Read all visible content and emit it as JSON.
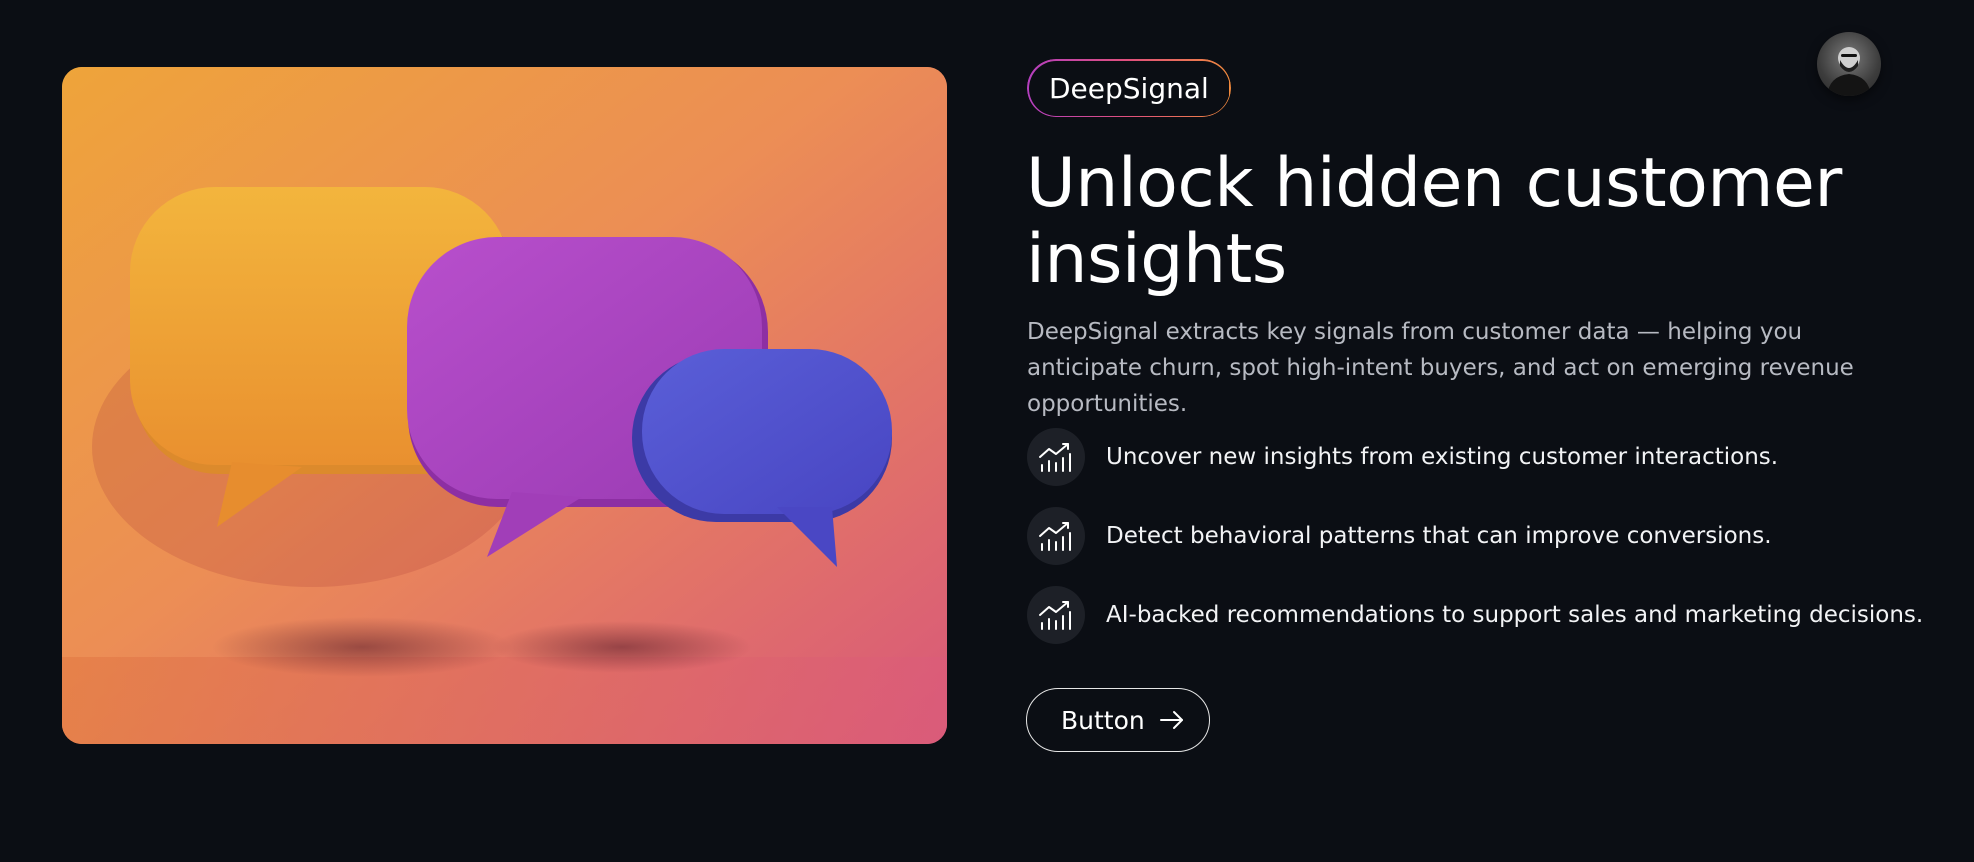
{
  "brand": {
    "label": "DeepSignal"
  },
  "hero": {
    "title": "Unlock hidden customer insights",
    "description": "DeepSignal extracts key signals from customer data — helping you anticipate churn, spot high-intent buyers, and act on emerging revenue opportunities."
  },
  "features": [
    {
      "icon": "chart-trend-icon",
      "text": "Uncover new insights from existing customer interactions."
    },
    {
      "icon": "chart-trend-icon",
      "text": "Detect behavioral patterns that can improve conversions."
    },
    {
      "icon": "chart-trend-icon",
      "text": "AI-backed recommendations to support sales and marketing decisions."
    }
  ],
  "cta": {
    "label": "Button",
    "icon": "arrow-right-icon"
  },
  "user": {
    "avatar": "user-avatar"
  },
  "colors": {
    "background": "#0b0e14",
    "icon_circle": "#1d2027",
    "pill_gradient": [
      "#b43fbf",
      "#e1507c",
      "#f08a3c"
    ]
  }
}
